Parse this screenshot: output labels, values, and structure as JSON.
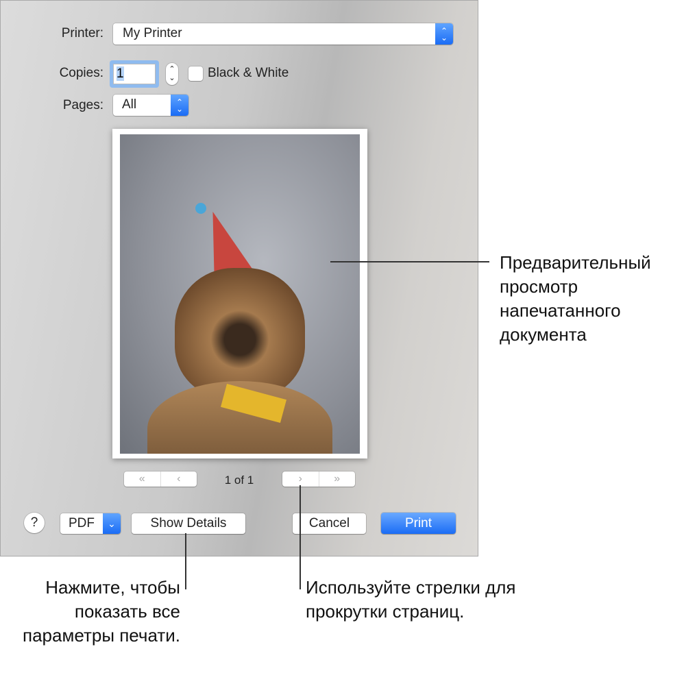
{
  "dialog": {
    "printer_label": "Printer:",
    "printer_value": "My Printer",
    "copies_label": "Copies:",
    "copies_value": "1",
    "bw_label": "Black & White",
    "bw_checked": false,
    "pages_label": "Pages:",
    "pages_value": "All",
    "page_indicator": "1 of 1",
    "nav": {
      "first": "«",
      "prev": "‹",
      "next": "›",
      "last": "»"
    },
    "help_label": "?",
    "pdf_label": "PDF",
    "show_details_label": "Show Details",
    "cancel_label": "Cancel",
    "print_label": "Print",
    "accent_color": "#1a6cf5"
  },
  "annotations": {
    "preview": "Предварительный просмотр напечатанного документа",
    "details": "Нажмите, чтобы показать все параметры печати.",
    "arrows": "Используйте стрелки для прокрутки страниц."
  }
}
